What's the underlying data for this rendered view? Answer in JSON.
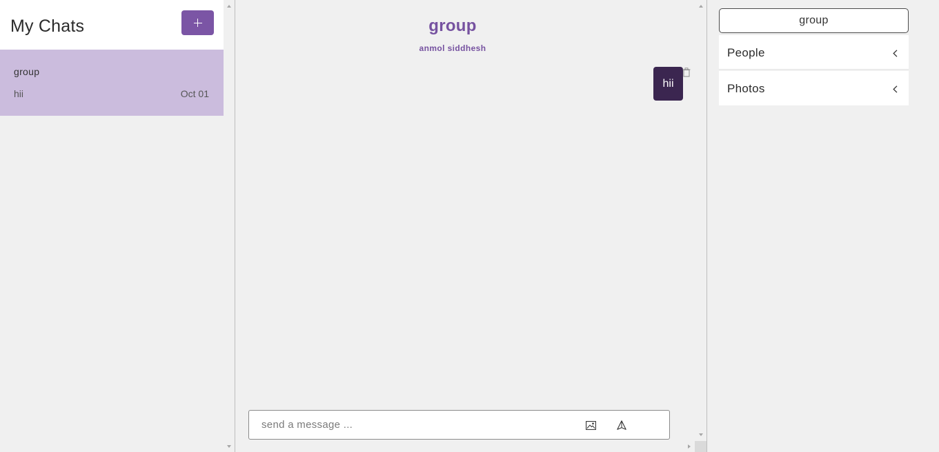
{
  "sidebar": {
    "title": "My Chats",
    "new_chat_icon": "plus-icon",
    "chats": [
      {
        "name": "group",
        "last_message": "hii",
        "date": "Oct 01"
      }
    ]
  },
  "chat": {
    "title": "group",
    "members": "anmol siddhesh",
    "messages": [
      {
        "text": "hii"
      }
    ],
    "composer": {
      "placeholder": "send a message ...",
      "image_icon": "image-icon",
      "send_icon": "send-icon"
    }
  },
  "details": {
    "group_name": "group",
    "sections": [
      {
        "label": "People"
      },
      {
        "label": "Photos"
      }
    ]
  },
  "colors": {
    "accent": "#7b55a5",
    "selected_chat": "#cbbcdd",
    "message_bubble": "#3b2650"
  }
}
